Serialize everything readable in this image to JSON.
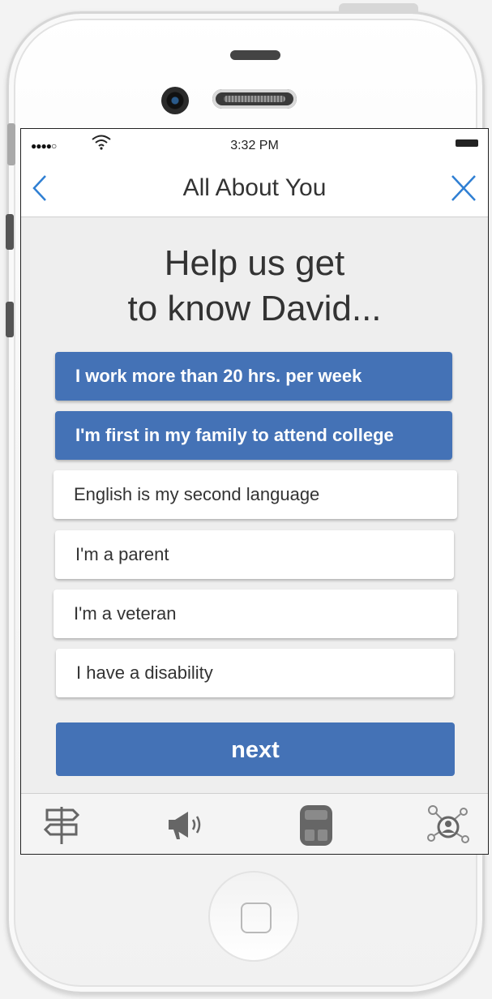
{
  "status_bar": {
    "signal": "●●●●○",
    "time": "3:32 PM"
  },
  "nav": {
    "title": "All About You"
  },
  "headline": {
    "line1": "Help us get",
    "line2": "to know David..."
  },
  "options": [
    {
      "label": "I work more than 20 hrs. per week",
      "selected": true
    },
    {
      "label": "I'm first in my family to attend college",
      "selected": true
    },
    {
      "label": "English is my second language",
      "selected": false
    },
    {
      "label": "I'm a parent",
      "selected": false
    },
    {
      "label": "I'm a veteran",
      "selected": false
    },
    {
      "label": "I have a disability",
      "selected": false
    }
  ],
  "next_button": {
    "label": "next"
  },
  "tab_bar": {
    "items": [
      {
        "icon": "signpost-icon"
      },
      {
        "icon": "megaphone-icon"
      },
      {
        "icon": "backpack-icon"
      },
      {
        "icon": "network-profile-icon"
      }
    ]
  },
  "colors": {
    "accent": "#4472b6",
    "nav_icon": "#2f7fd3",
    "text": "#333333",
    "screen_bg": "#eeeeee"
  }
}
